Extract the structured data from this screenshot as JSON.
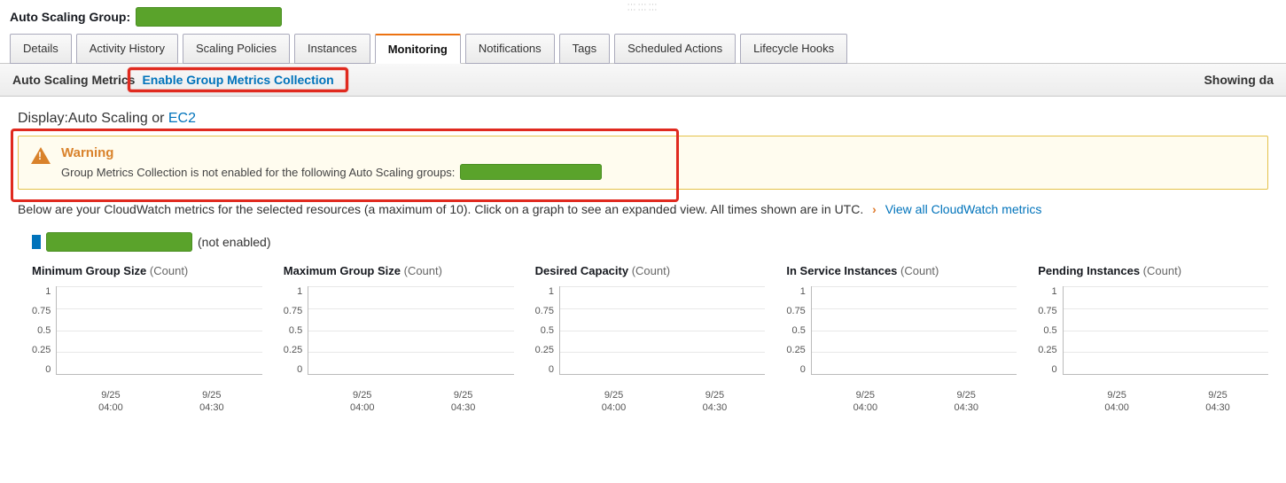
{
  "header": {
    "label": "Auto Scaling Group:"
  },
  "tabs": [
    {
      "id": "details",
      "label": "Details"
    },
    {
      "id": "activity",
      "label": "Activity History"
    },
    {
      "id": "policies",
      "label": "Scaling Policies"
    },
    {
      "id": "instances",
      "label": "Instances"
    },
    {
      "id": "monitoring",
      "label": "Monitoring",
      "active": true
    },
    {
      "id": "notifications",
      "label": "Notifications"
    },
    {
      "id": "tags",
      "label": "Tags"
    },
    {
      "id": "scheduled",
      "label": "Scheduled Actions"
    },
    {
      "id": "lifecycle",
      "label": "Lifecycle Hooks"
    }
  ],
  "sub_bar": {
    "metrics_label": "Auto Scaling Metrics",
    "enable_link": "Enable Group Metrics Collection",
    "showing": "Showing da"
  },
  "display_line": {
    "prefix": "Display:",
    "current": "Auto Scaling",
    "or": " or ",
    "alt": "EC2"
  },
  "warning": {
    "title": "Warning",
    "message": "Group Metrics Collection is not enabled for the following Auto Scaling groups:"
  },
  "info": {
    "text": "Below are your CloudWatch metrics for the selected resources (a maximum of 10). Click on a graph to see an expanded view. All times shown are in UTC.",
    "link": "View all CloudWatch metrics"
  },
  "resource": {
    "status": "(not enabled)"
  },
  "chart_axes": {
    "y_ticks": [
      "1",
      "0.75",
      "0.5",
      "0.25",
      "0"
    ],
    "x_ticks": [
      {
        "date": "9/25",
        "time": "04:00"
      },
      {
        "date": "9/25",
        "time": "04:30"
      }
    ]
  },
  "chart_data": [
    {
      "type": "line",
      "title": "Minimum Group Size",
      "unit": "(Count)",
      "ylim": [
        0,
        1
      ],
      "series": [
        {
          "name": "",
          "values": []
        }
      ],
      "x": [
        "9/25 04:00",
        "9/25 04:30"
      ]
    },
    {
      "type": "line",
      "title": "Maximum Group Size",
      "unit": "(Count)",
      "ylim": [
        0,
        1
      ],
      "series": [
        {
          "name": "",
          "values": []
        }
      ],
      "x": [
        "9/25 04:00",
        "9/25 04:30"
      ]
    },
    {
      "type": "line",
      "title": "Desired Capacity",
      "unit": "(Count)",
      "ylim": [
        0,
        1
      ],
      "series": [
        {
          "name": "",
          "values": []
        }
      ],
      "x": [
        "9/25 04:00",
        "9/25 04:30"
      ]
    },
    {
      "type": "line",
      "title": "In Service Instances",
      "unit": "(Count)",
      "ylim": [
        0,
        1
      ],
      "series": [
        {
          "name": "",
          "values": []
        }
      ],
      "x": [
        "9/25 04:00",
        "9/25 04:30"
      ]
    },
    {
      "type": "line",
      "title": "Pending Instances",
      "unit": "(Count)",
      "ylim": [
        0,
        1
      ],
      "series": [
        {
          "name": "",
          "values": []
        }
      ],
      "x": [
        "9/25 04:00",
        "9/25 04:30"
      ]
    }
  ]
}
